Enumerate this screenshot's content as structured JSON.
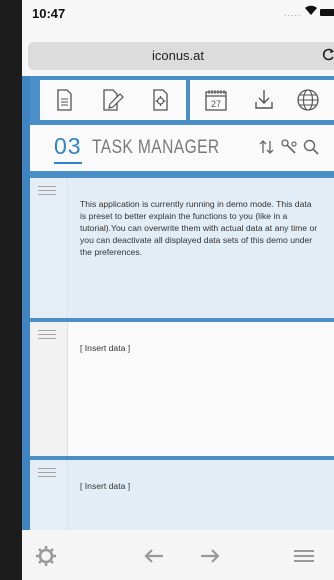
{
  "status": {
    "time": "10:47",
    "signal": "....."
  },
  "browser": {
    "url": "iconus.at"
  },
  "toolbar": {
    "left": [
      "document-icon",
      "edit-document-icon",
      "settings-document-icon"
    ],
    "right": [
      "calendar-icon",
      "download-icon",
      "globe-icon"
    ],
    "calendar_day": "27"
  },
  "header": {
    "number": "03",
    "title": "TASK MANAGER"
  },
  "rows": [
    {
      "text": "This application is currently running in demo mode. This data is preset to better explain the functions to you (like in a tutorial).You can overwrite them with actual data at any time or you can deactivate all displayed data sets of this demo under the preferences."
    },
    {
      "text": "[ Insert data ]"
    },
    {
      "text": "[ Insert data ]"
    }
  ],
  "bottom": [
    "gear-icon",
    "arrow-left-icon",
    "arrow-right-icon",
    "menu-icon"
  ],
  "colors": {
    "accent": "#2f84c6",
    "bar": "#4a8fc8",
    "row_blue": "#e2edf6"
  }
}
